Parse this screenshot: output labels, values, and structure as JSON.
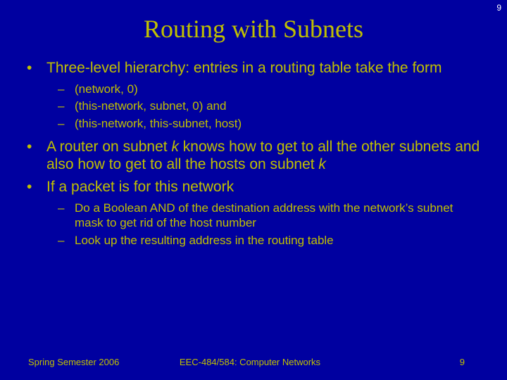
{
  "page_number_top": "9",
  "title": "Routing with Subnets",
  "bullets": [
    {
      "text": "Three-level hierarchy: entries in a routing table take the form",
      "subs": [
        "(network, 0)",
        "(this-network, subnet, 0) and",
        "(this-network, this-subnet, host)"
      ]
    },
    {
      "text_html": "A router on subnet <span class=\"italic\">k</span> knows how to get to all the other subnets and also how to get to all the hosts on subnet <span class=\"italic\">k</span>",
      "subs": []
    },
    {
      "text": "If a packet is for this network",
      "subs": [
        "Do a Boolean AND of the destination address with the network’s subnet mask to get rid of the host number",
        "Look up the resulting address in the routing table"
      ]
    }
  ],
  "footer": {
    "left": "Spring Semester 2006",
    "center": "EEC-484/584: Computer Networks",
    "right": "9"
  }
}
